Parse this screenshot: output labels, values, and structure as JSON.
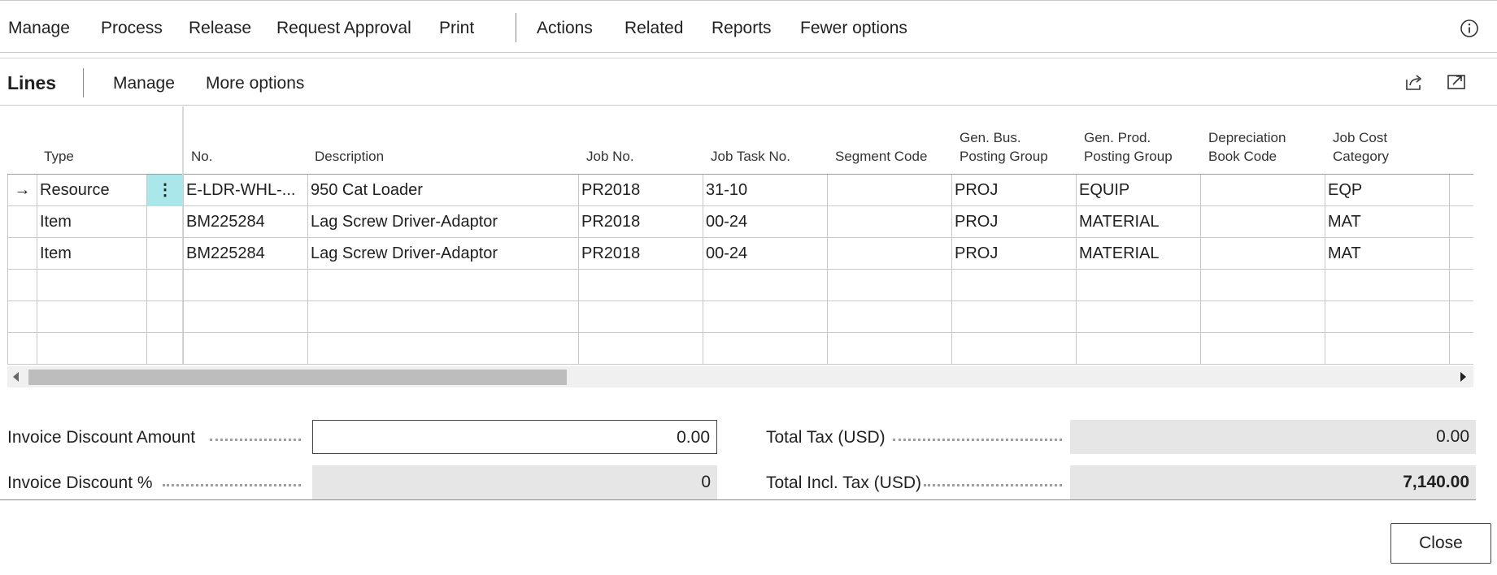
{
  "action_bar": {
    "items": [
      "Manage",
      "Process",
      "Release",
      "Request Approval",
      "Print",
      "Actions",
      "Related",
      "Reports",
      "Fewer options"
    ],
    "info_icon": "info-icon"
  },
  "lines": {
    "title": "Lines",
    "menu": [
      "Manage",
      "More options"
    ],
    "icons": [
      "share-icon",
      "expand-icon"
    ]
  },
  "table": {
    "columns": [
      {
        "label": "Type"
      },
      {
        "label": "No."
      },
      {
        "label": "Description"
      },
      {
        "label": "Job No."
      },
      {
        "label": "Job Task No."
      },
      {
        "label": "Segment Code"
      },
      {
        "label": "Gen. Bus. Posting Group",
        "line1": "Gen. Bus.",
        "line2": "Posting Group"
      },
      {
        "label": "Gen. Prod. Posting Group",
        "line1": "Gen. Prod.",
        "line2": "Posting Group"
      },
      {
        "label": "Depreciation Book Code",
        "line1": "Depreciation",
        "line2": "Book Code"
      },
      {
        "label": "Job Cost Category",
        "line1": "Job Cost",
        "line2": "Category"
      }
    ],
    "rows": [
      {
        "type": "Resource",
        "no": "E-LDR-WHL-...",
        "description": "950 Cat Loader",
        "job_no": "PR2018",
        "job_task_no": "31-10",
        "segment_code": "",
        "gen_bus": "PROJ",
        "gen_prod": "EQUIP",
        "depr_book": "",
        "job_cost_cat": "EQP"
      },
      {
        "type": "Item",
        "no": "BM225284",
        "description": "Lag Screw Driver-Adaptor",
        "job_no": "PR2018",
        "job_task_no": "00-24",
        "segment_code": "",
        "gen_bus": "PROJ",
        "gen_prod": "MATERIAL",
        "depr_book": "",
        "job_cost_cat": "MAT"
      },
      {
        "type": "Item",
        "no": "BM225284",
        "description": "Lag Screw Driver-Adaptor",
        "job_no": "PR2018",
        "job_task_no": "00-24",
        "segment_code": "",
        "gen_bus": "PROJ",
        "gen_prod": "MATERIAL",
        "depr_book": "",
        "job_cost_cat": "MAT"
      }
    ],
    "selected_row_marker": "→",
    "row_menu_glyph": "⋮"
  },
  "totals": {
    "invoice_discount_amount_label": "Invoice Discount Amount",
    "invoice_discount_amount": "0.00",
    "invoice_discount_pct_label": "Invoice Discount %",
    "invoice_discount_pct": "0",
    "total_tax_label": "Total Tax (USD)",
    "total_tax": "0.00",
    "total_incl_tax_label": "Total Incl. Tax (USD)",
    "total_incl_tax": "7,140.00"
  },
  "footer": {
    "close_label": "Close"
  }
}
